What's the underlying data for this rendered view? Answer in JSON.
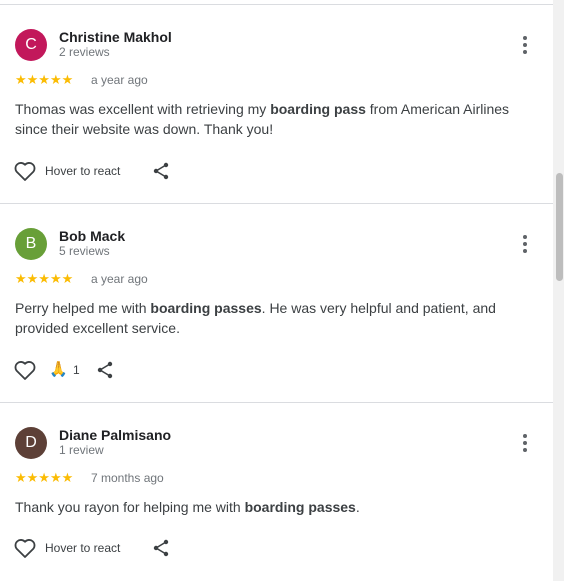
{
  "reviews": [
    {
      "avatar_letter": "C",
      "avatar_color": "#c2185b",
      "name": "Christine Makhol",
      "review_count": "2 reviews",
      "rating": 5,
      "stars": "★★★★★",
      "time": "a year ago",
      "text_segments": [
        "Thomas was excellent with retrieving my ",
        "boarding pass",
        " from American Airlines since their website was down. Thank you!"
      ],
      "react_label": "Hover to react",
      "icons": {
        "more": "more-vert-icon",
        "like": "heart-outline-icon",
        "share": "share-icon"
      }
    },
    {
      "avatar_letter": "B",
      "avatar_color": "#689f38",
      "name": "Bob Mack",
      "review_count": "5 reviews",
      "rating": 5,
      "stars": "★★★★★",
      "time": "a year ago",
      "text_segments": [
        "Perry helped me with ",
        "boarding passes",
        ". He was very helpful and patient, and provided excellent service."
      ],
      "reaction_emoji": "🙏",
      "reaction_count": "1",
      "icons": {
        "more": "more-vert-icon",
        "like": "heart-outline-icon",
        "reaction": "folded-hands-emoji",
        "share": "share-icon"
      }
    },
    {
      "avatar_letter": "D",
      "avatar_color": "#5d4037",
      "name": "Diane Palmisano",
      "review_count": "1 review",
      "rating": 5,
      "stars": "★★★★★",
      "time": "7 months ago",
      "text_segments": [
        "Thank you rayon for helping me with ",
        "boarding passes",
        "."
      ],
      "react_label": "Hover to react",
      "icons": {
        "more": "more-vert-icon",
        "like": "heart-outline-icon",
        "share": "share-icon"
      }
    }
  ],
  "colors": {
    "star": "#fbbc04",
    "name_text": "#202124",
    "secondary_text": "#70757a",
    "divider": "#dadce0"
  }
}
